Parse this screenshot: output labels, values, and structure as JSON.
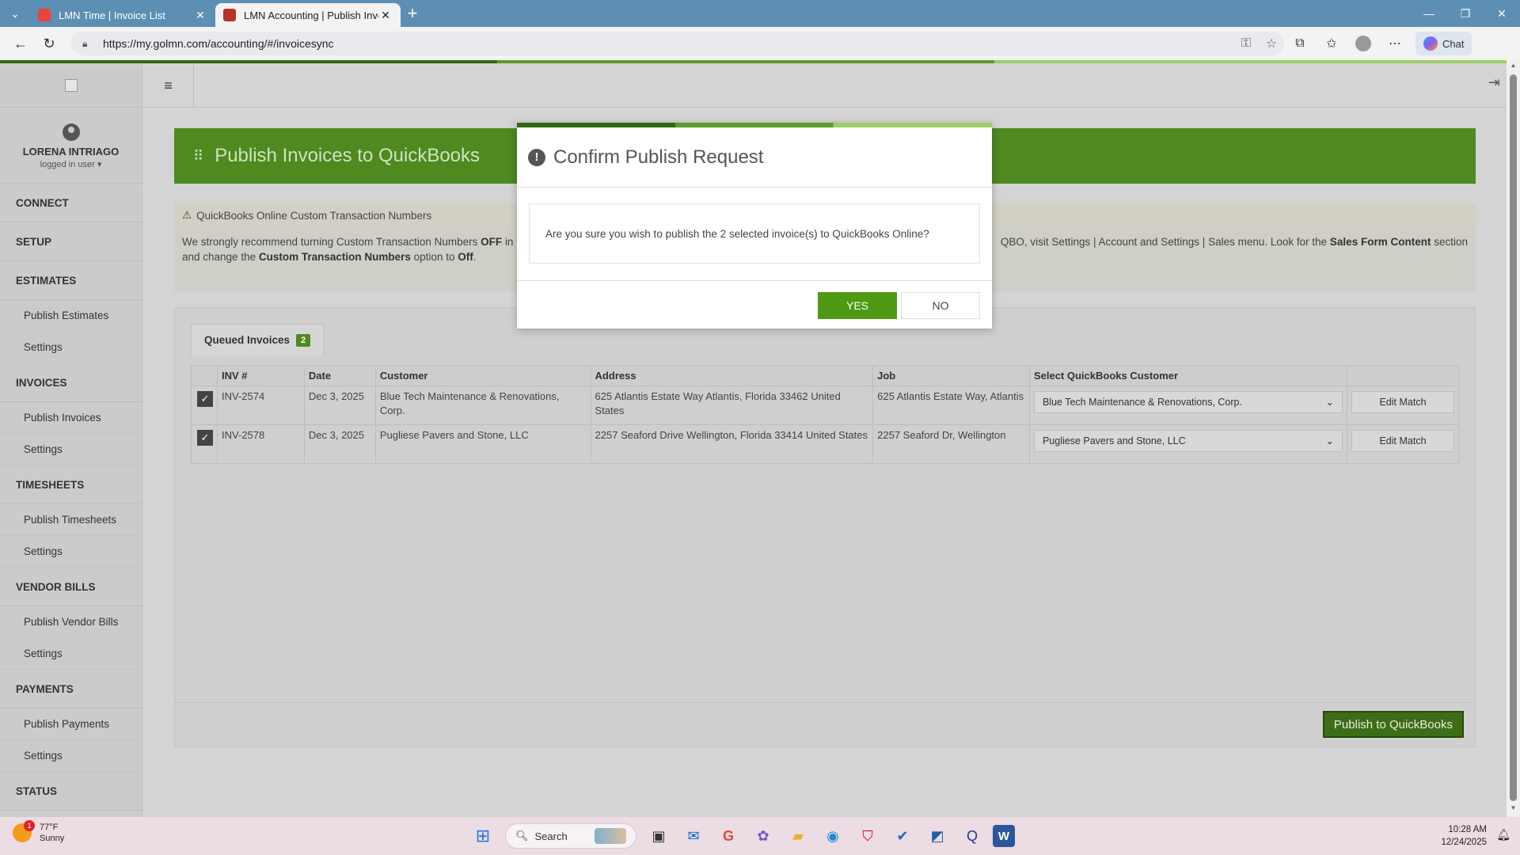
{
  "browser": {
    "tabs": [
      {
        "title": "LMN Time | Invoice List",
        "favicon_color": "#e8453c",
        "active": false
      },
      {
        "title": "LMN Accounting | Publish Invoic",
        "favicon_color": "#b8332a",
        "active": true
      }
    ],
    "url": "https://my.golmn.com/accounting/#/invoicesync",
    "chat_label": "Chat"
  },
  "sidebar": {
    "user_name": "LORENA INTRIAGO",
    "user_sub": "logged in user ▾",
    "sections": [
      {
        "label": "CONNECT",
        "items": []
      },
      {
        "label": "SETUP",
        "items": []
      },
      {
        "label": "ESTIMATES",
        "items": [
          "Publish Estimates",
          "Settings"
        ]
      },
      {
        "label": "INVOICES",
        "items": [
          "Publish Invoices",
          "Settings"
        ]
      },
      {
        "label": "TIMESHEETS",
        "items": [
          "Publish Timesheets",
          "Settings"
        ]
      },
      {
        "label": "VENDOR BILLS",
        "items": [
          "Publish Vendor Bills",
          "Settings"
        ]
      },
      {
        "label": "PAYMENTS",
        "items": [
          "Publish Payments",
          "Settings"
        ]
      },
      {
        "label": "STATUS",
        "items": []
      }
    ]
  },
  "page": {
    "title": "Publish Invoices to QuickBooks",
    "notice_title": "QuickBooks Online Custom Transaction Numbers",
    "notice_line1_a": "We strongly recommend turning Custom Transaction Numbers",
    "notice_line1_b": "OFF",
    "notice_line1_c": "in",
    "notice_line1_d": "QBO, visit Settings | Account and Settings | Sales menu. Look for the",
    "notice_line1_e": "Sales Form Content",
    "notice_line1_f": "section",
    "notice_line2_a": "and change the",
    "notice_line2_b": "Custom Transaction Numbers",
    "notice_line2_c": "option to",
    "notice_line2_d": "Off",
    "notice_line2_e": ".",
    "queued_tab_label": "Queued Invoices",
    "queued_count": "2",
    "columns": [
      "INV #",
      "Date",
      "Customer",
      "Address",
      "Job",
      "Select QuickBooks Customer"
    ],
    "rows": [
      {
        "checked": true,
        "inv": "INV-2574",
        "date": "Dec 3, 2025",
        "customer": "Blue Tech Maintenance & Renovations, Corp.",
        "address": "625 Atlantis Estate Way Atlantis, Florida 33462 United States",
        "job": "625 Atlantis Estate Way, Atlantis",
        "qb_customer": "Blue Tech Maintenance & Renovations, Corp.",
        "action": "Edit Match"
      },
      {
        "checked": true,
        "inv": "INV-2578",
        "date": "Dec 3, 2025",
        "customer": "Pugliese Pavers and Stone, LLC",
        "address": "2257 Seaford Drive Wellington, Florida 33414 United States",
        "job": "2257 Seaford Dr, Wellington",
        "qb_customer": "Pugliese Pavers and Stone, LLC",
        "action": "Edit Match"
      }
    ],
    "publish_button": "Publish to QuickBooks"
  },
  "modal": {
    "title": "Confirm Publish Request",
    "message": "Are you sure you wish to publish the 2 selected invoice(s) to QuickBooks Online?",
    "yes_label": "YES",
    "no_label": "NO"
  },
  "taskbar": {
    "weather_temp": "77°F",
    "weather_desc": "Sunny",
    "weather_badge": "1",
    "search_placeholder": "Search",
    "time": "10:28 AM",
    "date": "12/24/2025"
  }
}
